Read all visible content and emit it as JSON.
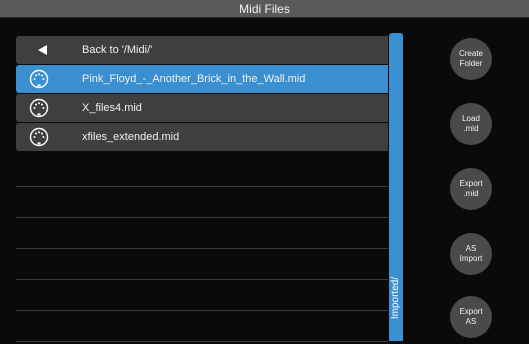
{
  "window": {
    "title": "Midi Files"
  },
  "file_list": {
    "back_label": "Back to '/Midi/'",
    "files": [
      {
        "name": "Pink_Floyd_-_Another_Brick_in_the_Wall.mid",
        "selected": true
      },
      {
        "name": "X_files4.mid",
        "selected": false
      },
      {
        "name": "xfiles_extended.mid",
        "selected": false
      }
    ],
    "icon": "midi-connector-icon"
  },
  "folder_tab": {
    "label": "Imported/"
  },
  "side_buttons": [
    {
      "label": "Create\nFolder"
    },
    {
      "label": "Load\n.mid"
    },
    {
      "label": "Export\n.mid"
    },
    {
      "label": "AS\nImport"
    },
    {
      "label": "Export\nAS"
    }
  ],
  "colors": {
    "accent": "#3a8fd0",
    "row_bg": "#3f3f3f",
    "title_bar": "#5a5a5a",
    "button_bg": "#4a4a4a"
  }
}
